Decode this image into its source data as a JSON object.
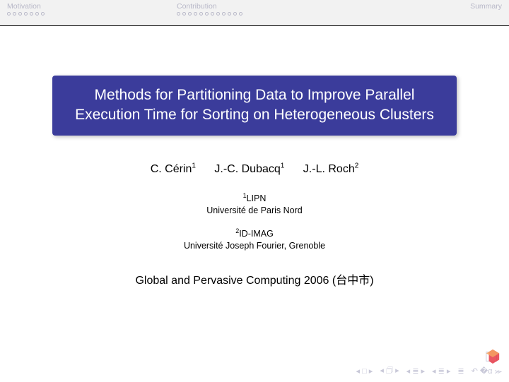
{
  "header": {
    "tabs": [
      {
        "label": "Motivation",
        "dots": 7
      },
      {
        "label": "Contribution",
        "dots": 12
      },
      {
        "label": "Summary",
        "dots": 0
      }
    ]
  },
  "title": "Methods for Partitioning Data to Improve Parallel Execution Time for Sorting on Heterogeneous Clusters",
  "authors": [
    {
      "name": "C. Cérin",
      "aff": "1"
    },
    {
      "name": "J.-C. Dubacq",
      "aff": "1"
    },
    {
      "name": "J.-L. Roch",
      "aff": "2"
    }
  ],
  "affiliations": [
    {
      "num": "1",
      "name": "LIPN",
      "inst": "Université de Paris Nord"
    },
    {
      "num": "2",
      "name": "ID-IMAG",
      "inst": "Université Joseph Fourier, Grenoble"
    }
  ],
  "conference": "Global and Pervasive Computing 2006 (台中市)",
  "nav": {
    "first": "◂ □ ▸",
    "prevsec": "◂ 🗇 ▸",
    "prev": "◂ ≣ ▸",
    "next": "◂ ≣ ▸",
    "toggle": "≣",
    "back": "↶ �α ⪼"
  }
}
